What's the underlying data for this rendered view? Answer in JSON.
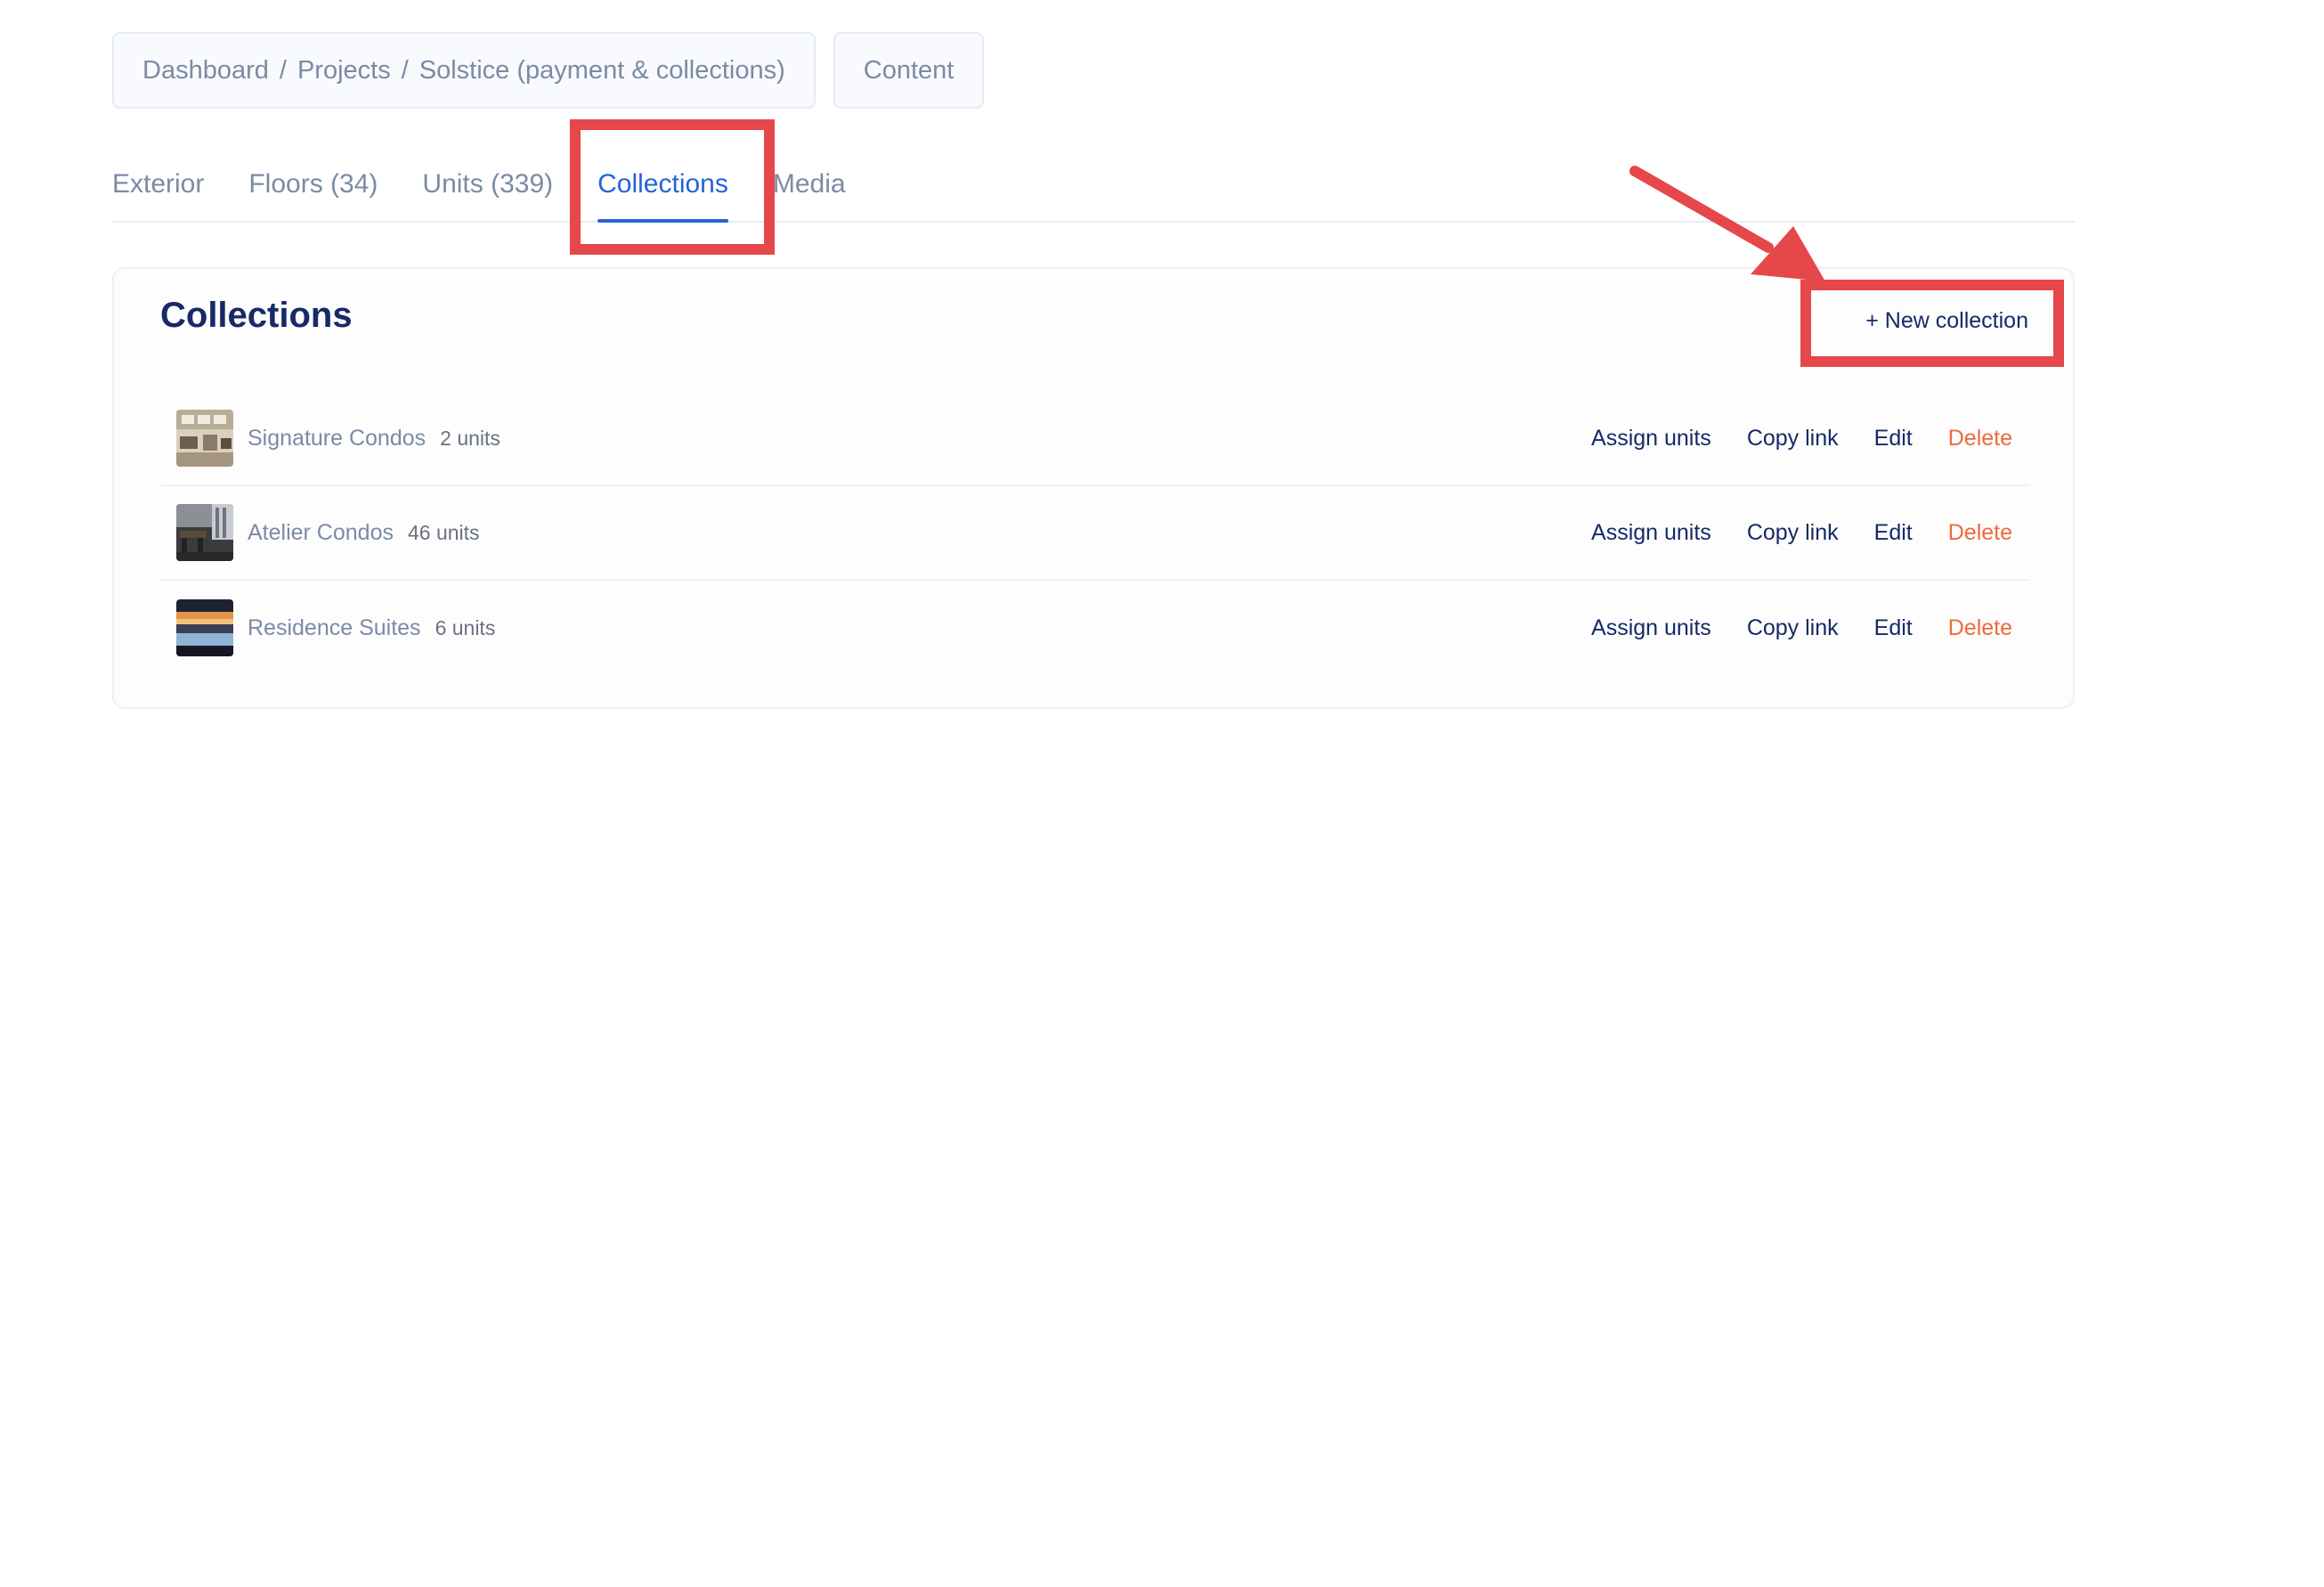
{
  "breadcrumb": {
    "items": [
      "Dashboard",
      "Projects",
      "Solstice (payment & collections)"
    ],
    "separator": "/",
    "content_button": "Content"
  },
  "tabs": [
    {
      "label": "Exterior",
      "active": false
    },
    {
      "label": "Floors (34)",
      "active": false
    },
    {
      "label": "Units (339)",
      "active": false
    },
    {
      "label": "Collections",
      "active": true
    },
    {
      "label": "Media",
      "active": false
    }
  ],
  "collections": {
    "title": "Collections",
    "new_button": "+ New collection",
    "actions": {
      "assign": "Assign units",
      "copy": "Copy link",
      "edit": "Edit",
      "delete": "Delete"
    },
    "items": [
      {
        "name": "Signature Condos",
        "count": "2 units",
        "thumb": "interior-icon"
      },
      {
        "name": "Atelier Condos",
        "count": "46 units",
        "thumb": "dining-icon"
      },
      {
        "name": "Residence Suites",
        "count": "6 units",
        "thumb": "pool-sunset-icon"
      }
    ]
  },
  "colors": {
    "accent": "#2563d8",
    "title": "#162a66",
    "muted": "#7c8aa5",
    "danger": "#ee6a3c",
    "annotation": "#e6474b"
  }
}
